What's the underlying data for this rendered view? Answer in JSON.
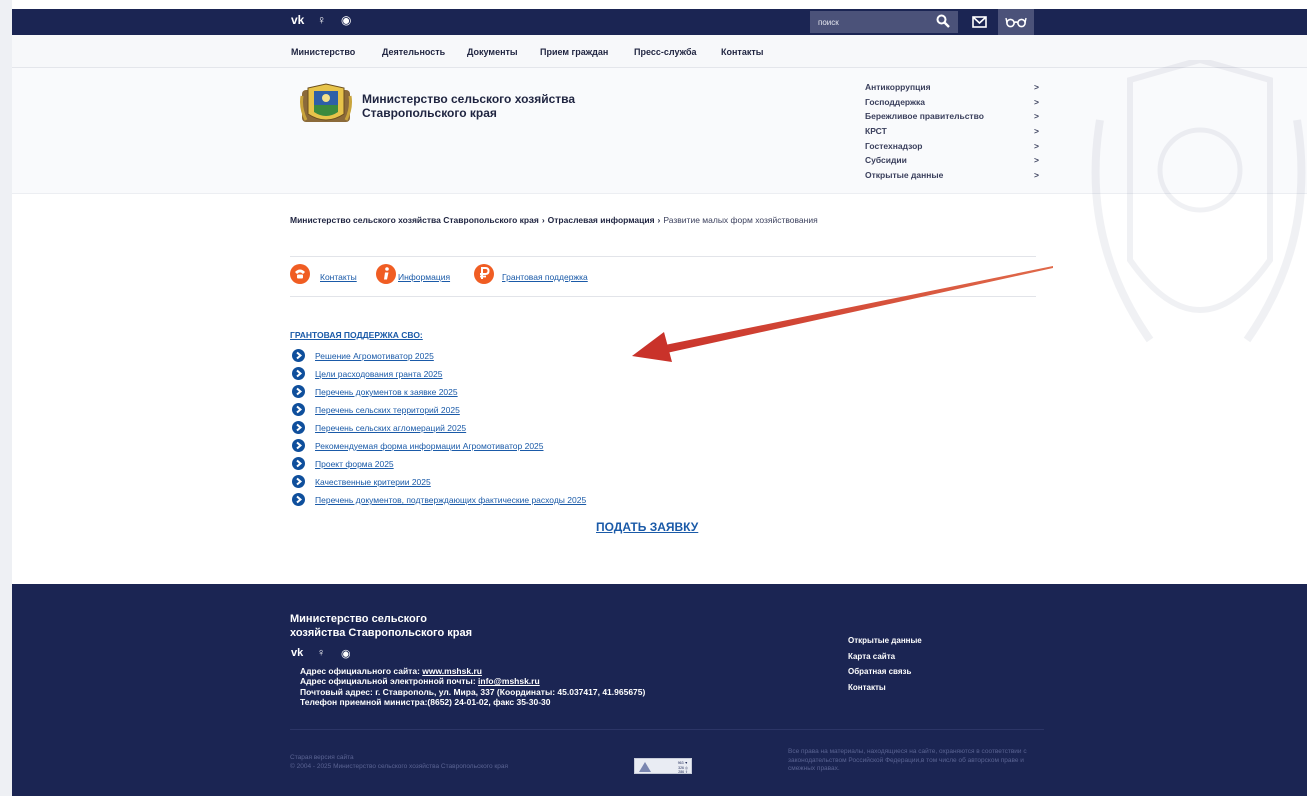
{
  "topbar": {
    "social": [
      "vk",
      "ok",
      "tg"
    ],
    "social_labels": {
      "vk": "vk",
      "ok": "♀",
      "tg": "◉"
    },
    "search_placeholder": "поиск",
    "icons": {
      "search": "search-icon",
      "mail": "mail-icon",
      "accessibility": "glasses-icon"
    }
  },
  "nav": {
    "items": [
      "Министерство",
      "Деятельность",
      "Документы",
      "Прием граждан",
      "Пресс-служба",
      "Контакты"
    ]
  },
  "header": {
    "title_line1": "Министерство сельского хозяйства",
    "title_line2": "Ставропольского края",
    "side_links": [
      "Антикоррупция",
      "Господдержка",
      "Бережливое правительство",
      "КРСТ",
      "Гостехнадзор",
      "Субсидии",
      "Открытые данные"
    ],
    "side_arrow": ">"
  },
  "breadcrumb": {
    "items": [
      "Министерство сельского хозяйства Ставропольского края",
      "Отраслевая информация"
    ],
    "current": "Развитие малых форм хозяйствования",
    "separator": "›"
  },
  "tabs": [
    {
      "label": "Контакты",
      "icon": "phone-icon"
    },
    {
      "label": "Информация",
      "icon": "info-icon"
    },
    {
      "label": "Грантовая поддержка",
      "icon": "ruble-icon"
    }
  ],
  "section": {
    "title": "ГРАНТОВАЯ ПОДДЕРЖКА СВО:",
    "documents": [
      "Решение Агромотиватор 2025",
      "Цели расходования гранта 2025",
      "Перечень документов к заявке 2025",
      "Перечень сельских территорий 2025",
      "Перечень сельских агломераций 2025",
      "Рекомендуемая форма информации Агромотиватор 2025",
      "Проект форма 2025",
      "Качественные критерии 2025",
      "Перечень документов, подтверждающих фактические расходы 2025"
    ],
    "apply": "ПОДАТЬ ЗАЯВКУ"
  },
  "footer": {
    "title_line1": "Министерство сельского",
    "title_line2": "хозяйства Ставропольского края",
    "site_label": "Адрес официального сайта: ",
    "site_value": "www.mshsk.ru",
    "email_label": "Адрес официальной электронной почты: ",
    "email_value": "info@mshsk.ru",
    "address": "Почтовый адрес: г. Ставрополь, ул. Мира, 337 (Координаты: 45.037417, 41.965675)",
    "phone": "Телефон приемной министра:(8652) 24-01-02, факс 35-30-30",
    "links": [
      "Открытые данные",
      "Карта сайта",
      "Обратная связь",
      "Контакты"
    ],
    "old_version": "Старая версия сайта",
    "copyright": "© 2004 - 2025 Министерство сельского хозяйства Ставропольского края",
    "counter": [
      "963 ▼",
      "326 ◎",
      "286 ⇧"
    ],
    "rights": "Все права на материалы, находящиеся на сайте, охраняются в соответствии с законодательством Российской Федерации,в том числе об авторском праве и смежных правах."
  },
  "colors": {
    "navy": "#1b2553",
    "link": "#1a5aa8",
    "orange": "#f05d23",
    "arrow": "#d33a2c"
  }
}
